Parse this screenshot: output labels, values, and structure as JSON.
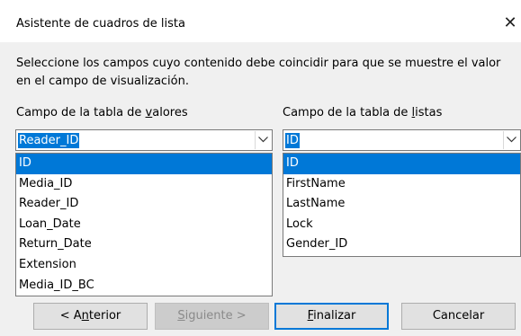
{
  "window": {
    "title": "Asistente de cuadros de lista",
    "close_glyph": "✕"
  },
  "instructions": "Seleccione los campos cuyo contenido debe coincidir para que se muestre el valor en el campo de visualización.",
  "left": {
    "label_pre": "Campo de la tabla de ",
    "label_key": "v",
    "label_post": "alores",
    "selected_value": "Reader_ID",
    "items": [
      "ID",
      "Media_ID",
      "Reader_ID",
      "Loan_Date",
      "Return_Date",
      "Extension",
      "Media_ID_BC"
    ],
    "highlighted_index": 0
  },
  "right": {
    "label_pre": "Campo de la tabla de ",
    "label_key": "l",
    "label_post": "istas",
    "selected_value": "ID",
    "items": [
      "ID",
      "FirstName",
      "LastName",
      "Lock",
      "Gender_ID"
    ],
    "highlighted_index": 0
  },
  "buttons": {
    "back": {
      "pre": "< A",
      "key": "n",
      "post": "terior"
    },
    "next": {
      "pre": "",
      "key": "S",
      "post": "iguiente >"
    },
    "finish": {
      "pre": "",
      "key": "F",
      "post": "inalizar"
    },
    "cancel": "Cancelar"
  },
  "colors": {
    "selection": "#0078d7",
    "dialog_bg": "#f0f0f0",
    "default_button_border": "#0078d7"
  },
  "icons": {
    "close": "close-icon",
    "dropdown": "chevron-down-icon"
  }
}
